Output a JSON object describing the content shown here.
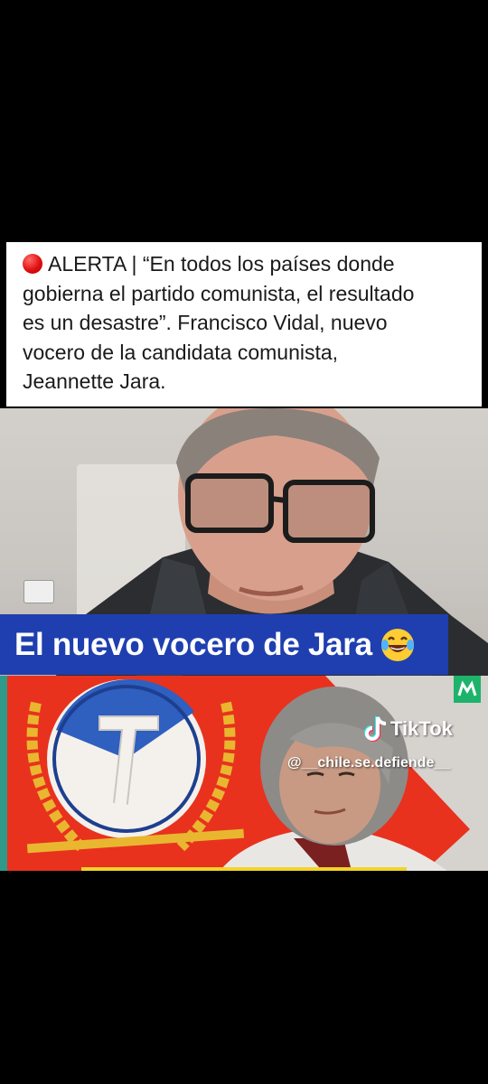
{
  "post": {
    "line1": "ALERTA | “En todos los países donde",
    "line2": "gobierna el partido comunista, el resultado",
    "line3": "es un desastre”. Francisco Vidal, nuevo",
    "line4": "vocero de la candidata comunista,",
    "line5": "Jeannette Jara."
  },
  "video": {
    "caption": "El nuevo vocero de Jara",
    "caption_emoji": "tears-of-joy-emoji"
  },
  "watermark": {
    "brand": "TikTok",
    "username": "@__chile.se.defiende__"
  },
  "colors": {
    "caption_bg": "#1f3fb0",
    "flag_red": "#e8321e",
    "emblem_blue": "#2f5fbf",
    "channel_green": "#1db36b"
  }
}
